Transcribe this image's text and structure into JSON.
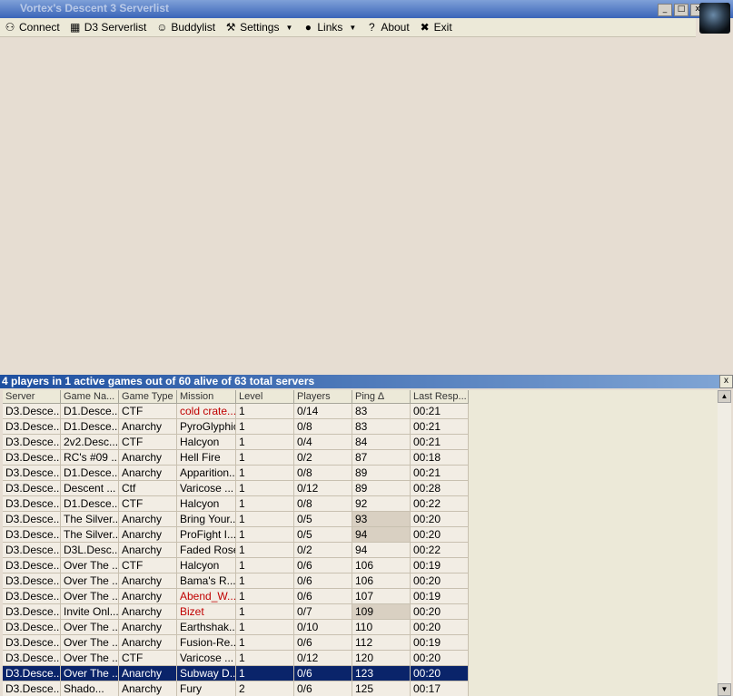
{
  "window": {
    "title": "Vortex's Descent 3 Serverlist",
    "buttons": [
      "_",
      "□",
      "x"
    ]
  },
  "toolbar": {
    "connect": "Connect",
    "serverlist": "D3 Serverlist",
    "buddylist": "Buddylist",
    "settings": "Settings",
    "links": "Links",
    "about": "About",
    "exit": "Exit"
  },
  "status": {
    "text": "4 players in 1 active games out of 60 alive of 63 total servers",
    "close": "x"
  },
  "grid": {
    "columns": [
      "Server",
      "Game Na...",
      "Game Type",
      "Mission",
      "Level",
      "Players",
      "Ping ∆",
      "Last Resp..."
    ],
    "rows": [
      [
        "D3.Desce...",
        "D1.Desce...",
        "CTF",
        "cold crate...",
        "1",
        "0/14",
        "83",
        "00:21"
      ],
      [
        "D3.Desce...",
        "D1.Desce...",
        "Anarchy",
        "PyroGlyphic",
        "1",
        "0/8",
        "83",
        "00:21"
      ],
      [
        "D3.Desce...",
        "2v2.Desc...",
        "CTF",
        "Halcyon",
        "1",
        "0/4",
        "84",
        "00:21"
      ],
      [
        "D3.Desce...",
        "RC's #09 ...",
        "Anarchy",
        "Hell Fire",
        "1",
        "0/2",
        "87",
        "00:18"
      ],
      [
        "D3.Desce...",
        "D1.Desce...",
        "Anarchy",
        "Apparition...",
        "1",
        "0/8",
        "89",
        "00:21"
      ],
      [
        "D3.Desce...",
        "Descent ...",
        "Ctf",
        "Varicose ...",
        "1",
        "0/12",
        "89",
        "00:28"
      ],
      [
        "D3.Desce...",
        "D1.Desce...",
        "CTF",
        "Halcyon",
        "1",
        "0/8",
        "92",
        "00:22"
      ],
      [
        "D3.Desce...",
        "The Silver...",
        "Anarchy",
        "Bring Your...",
        "1",
        "0/5",
        "93",
        "00:20"
      ],
      [
        "D3.Desce...",
        "The Silver...",
        "Anarchy",
        "ProFight I...",
        "1",
        "0/5",
        "94",
        "00:20"
      ],
      [
        "D3.Desce...",
        "D3L.Desc...",
        "Anarchy",
        "Faded Rose",
        "1",
        "0/2",
        "94",
        "00:22"
      ],
      [
        "D3.Desce...",
        "Over The ...",
        "CTF",
        "Halcyon",
        "1",
        "0/6",
        "106",
        "00:19"
      ],
      [
        "D3.Desce...",
        "Over The ...",
        "Anarchy",
        "Bama's R...",
        "1",
        "0/6",
        "106",
        "00:20"
      ],
      [
        "D3.Desce...",
        "Over The ...",
        "Anarchy",
        "Abend_W...",
        "1",
        "0/6",
        "107",
        "00:19"
      ],
      [
        "D3.Desce...",
        "Invite Onl...",
        "Anarchy",
        "Bizet",
        "1",
        "0/7",
        "109",
        "00:20"
      ],
      [
        "D3.Desce...",
        "Over The ...",
        "Anarchy",
        "Earthshak...",
        "1",
        "0/10",
        "110",
        "00:20"
      ],
      [
        "D3.Desce...",
        "Over The ...",
        "Anarchy",
        "Fusion-Re...",
        "1",
        "0/6",
        "112",
        "00:19"
      ],
      [
        "D3.Desce...",
        "Over The ...",
        "CTF",
        "Varicose ...",
        "1",
        "0/12",
        "120",
        "00:20"
      ],
      [
        "D3.Desce...",
        "Over The ...",
        "Anarchy",
        "Subway D...",
        "1",
        "0/6",
        "123",
        "00:20"
      ],
      [
        "D3.Desce...",
        "Shado...",
        "Anarchy",
        "Fury",
        "2",
        "0/6",
        "125",
        "00:17"
      ]
    ],
    "red_mission_rows": [
      0,
      12,
      13
    ],
    "highlight_ping_rows": [
      7,
      8,
      13
    ],
    "selected_row": 17
  },
  "colors": {
    "selection": "#0a246a",
    "status_bar": "#1e4fa0",
    "red_text": "#c00000",
    "background": "#e6ddd2"
  }
}
